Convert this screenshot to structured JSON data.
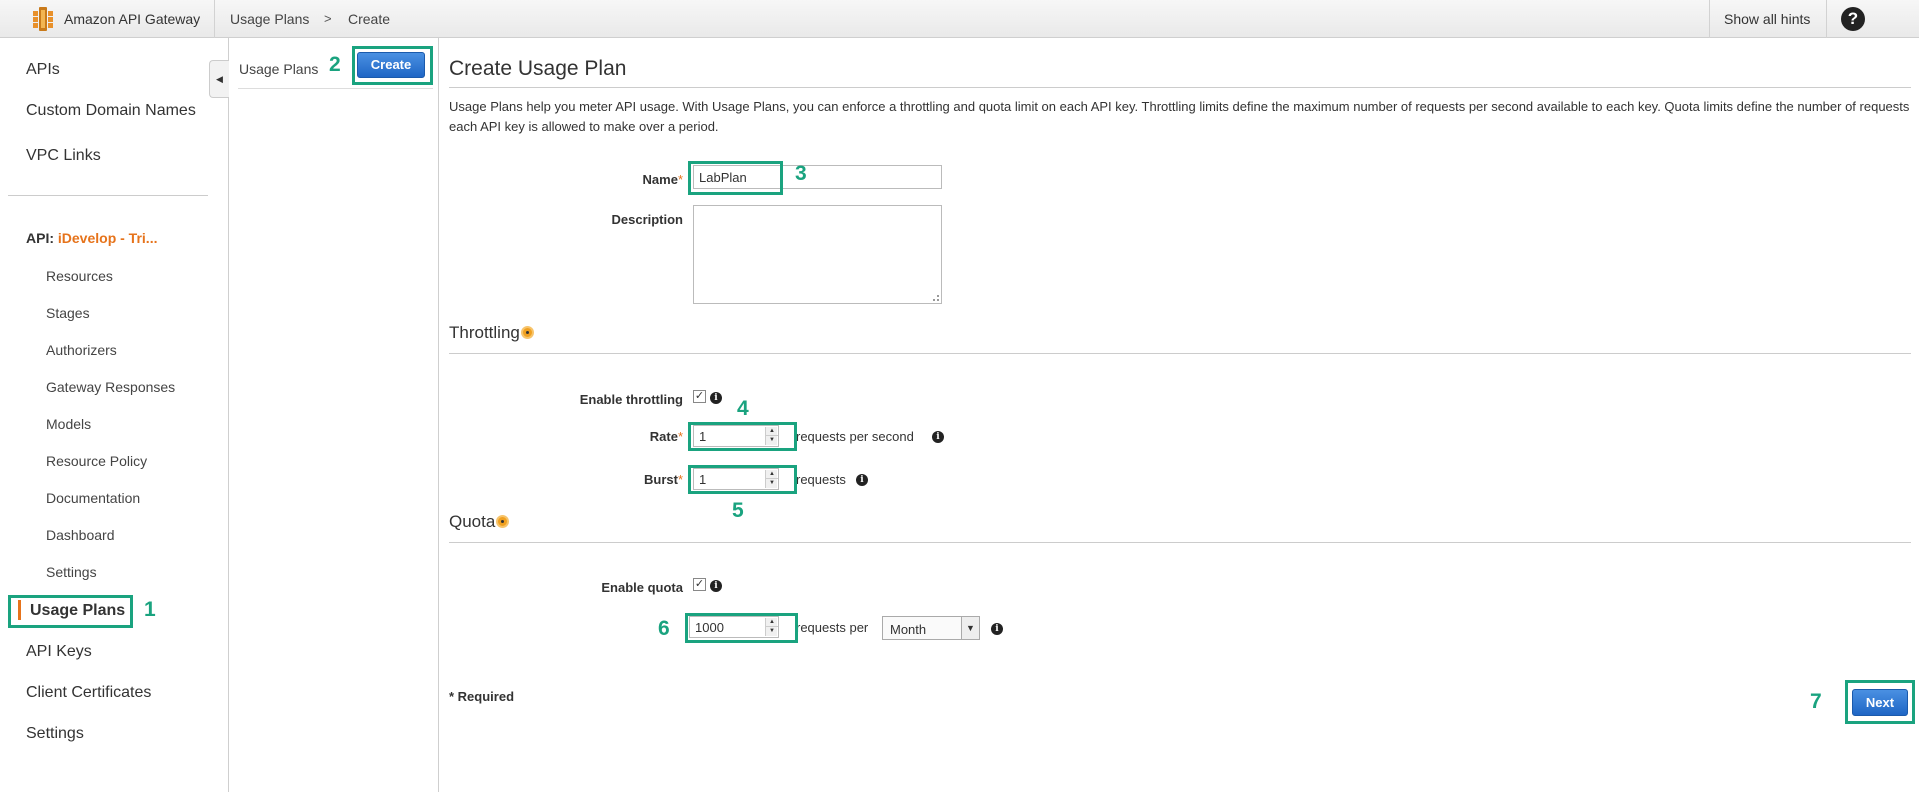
{
  "header": {
    "brand": "Amazon API Gateway",
    "breadcrumb": [
      "Usage Plans",
      "Create"
    ],
    "breadcrumb_separator": ">",
    "hints": "Show all hints",
    "help": "?"
  },
  "sidebar": {
    "top_items": [
      {
        "label": "APIs"
      },
      {
        "label": "Custom Domain Names"
      },
      {
        "label": "VPC Links"
      }
    ],
    "api_prefix": "API:",
    "api_name": "iDevelop - Tri...",
    "api_items": [
      {
        "label": "Resources"
      },
      {
        "label": "Stages"
      },
      {
        "label": "Authorizers"
      },
      {
        "label": "Gateway Responses"
      },
      {
        "label": "Models"
      },
      {
        "label": "Resource Policy"
      },
      {
        "label": "Documentation"
      },
      {
        "label": "Dashboard"
      },
      {
        "label": "Settings"
      }
    ],
    "bottom_items": [
      {
        "label": "Usage Plans",
        "active": true
      },
      {
        "label": "API Keys"
      },
      {
        "label": "Client Certificates"
      },
      {
        "label": "Settings"
      }
    ],
    "collapse_glyph": "◀"
  },
  "middle": {
    "title": "Usage Plans",
    "create_button": "Create"
  },
  "main": {
    "title": "Create Usage Plan",
    "description": "Usage Plans help you meter API usage. With Usage Plans, you can enforce a throttling and quota limit on each API key. Throttling limits define the maximum number of requests per second available to each key. Quota limits define the number of requests each API key is allowed to make over a period.",
    "name_label": "Name",
    "required_mark": "*",
    "name_value": "LabPlan",
    "description_label": "Description",
    "throttling": {
      "title": "Throttling",
      "enable_label": "Enable throttling",
      "enabled": true,
      "rate_label": "Rate",
      "rate_value": "1",
      "rate_suffix": "requests per second",
      "burst_label": "Burst",
      "burst_value": "1",
      "burst_suffix": "requests"
    },
    "quota": {
      "title": "Quota",
      "enable_label": "Enable quota",
      "enabled": true,
      "value": "1000",
      "suffix": "requests per",
      "period": "Month"
    },
    "required_note": "* Required",
    "next_button": "Next",
    "info_glyph": "i",
    "check_glyph": "✓"
  },
  "annotations": {
    "step1": "1",
    "step2": "2",
    "step3": "3",
    "step4": "4",
    "step5": "5",
    "step6": "6",
    "step7": "7"
  },
  "colors": {
    "accent_orange": "#e6731b",
    "button_blue": "#1f66c5",
    "annotation_green": "#1aa37f"
  }
}
